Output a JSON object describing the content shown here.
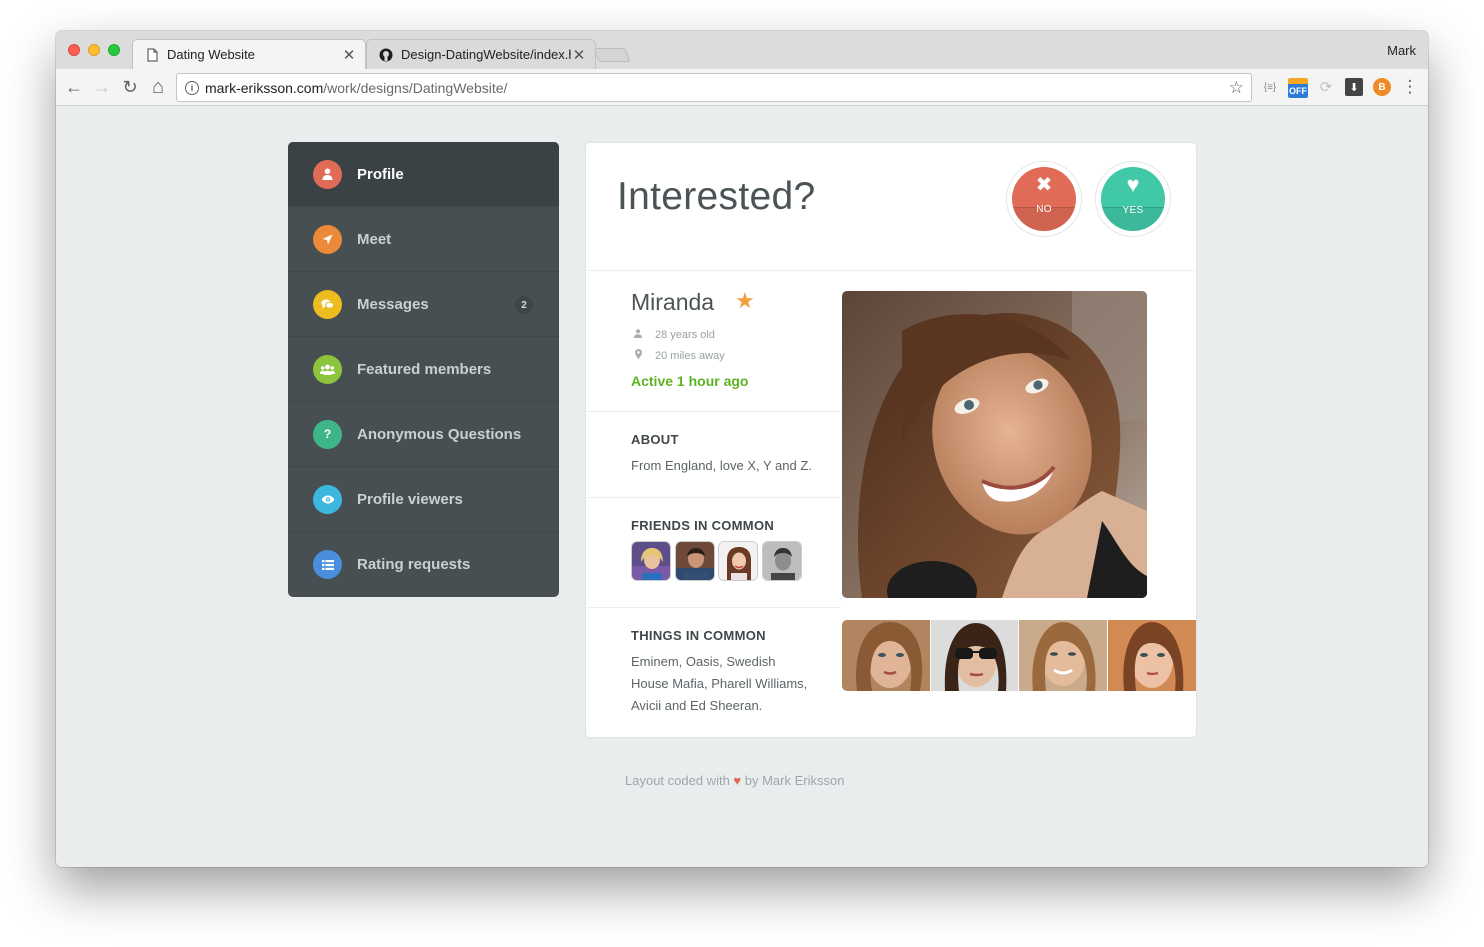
{
  "browser": {
    "tabs": [
      {
        "title": "Dating Website",
        "icon": "document-icon",
        "active": true
      },
      {
        "title": "Design-DatingWebsite/index.h",
        "icon": "github-icon",
        "active": false
      }
    ],
    "close_glyph": "✕",
    "profile": "Mark",
    "url_host": "mark-eriksson.com",
    "url_path": "/work/designs/DatingWebsite/",
    "nav": {
      "back": "←",
      "forward": "→",
      "reload": "↻",
      "home": "⌂"
    },
    "extensions": [
      {
        "name": "json-viewer-icon",
        "glyph": "{≡}"
      },
      {
        "name": "coupon-off-icon",
        "glyph": "OFF"
      },
      {
        "name": "sync-icon",
        "glyph": "⟳"
      },
      {
        "name": "download-icon",
        "glyph": "⬇"
      },
      {
        "name": "bitcoin-icon",
        "glyph": "B"
      },
      {
        "name": "menu-icon",
        "glyph": "⋮"
      }
    ]
  },
  "sidebar": {
    "items": [
      {
        "label": "Profile",
        "icon": "user-icon",
        "glyph": "●",
        "color": "#e06b57",
        "active": true
      },
      {
        "label": "Meet",
        "icon": "location-arrow-icon",
        "glyph": "➤",
        "color": "#eb8a38"
      },
      {
        "label": "Messages",
        "icon": "comments-icon",
        "glyph": "❝",
        "color": "#edbc20",
        "badge": "2"
      },
      {
        "label": "Featured members",
        "icon": "group-icon",
        "glyph": "☻",
        "color": "#8cc43d"
      },
      {
        "label": "Anonymous Questions",
        "icon": "question-icon",
        "glyph": "?",
        "color": "#3fb58a"
      },
      {
        "label": "Profile viewers",
        "icon": "eye-icon",
        "glyph": "◉",
        "color": "#3cb8de"
      },
      {
        "label": "Rating requests",
        "icon": "list-icon",
        "glyph": "☰",
        "color": "#4a8fdd"
      }
    ]
  },
  "card": {
    "heading": "Interested?",
    "no_label": "NO",
    "no_glyph": "✖",
    "yes_label": "YES",
    "yes_glyph": "♥",
    "name": "Miranda",
    "star_glyph": "★",
    "age": "28 years old",
    "distance": "20 miles away",
    "status": "Active 1 hour ago",
    "about_title": "ABOUT",
    "about_text": "From England, love X, Y and Z.",
    "friends_title": "FRIENDS IN COMMON",
    "things_title": "THINGS IN COMMON",
    "things_line1": "Eminem, Oasis, Swedish",
    "things_line2": "House Mafia, Pharell Williams,",
    "things_line3": "Avicii and Ed Sheeran."
  },
  "footer": {
    "before": "Layout coded with",
    "heart": "♥",
    "after": "by Mark Eriksson"
  }
}
